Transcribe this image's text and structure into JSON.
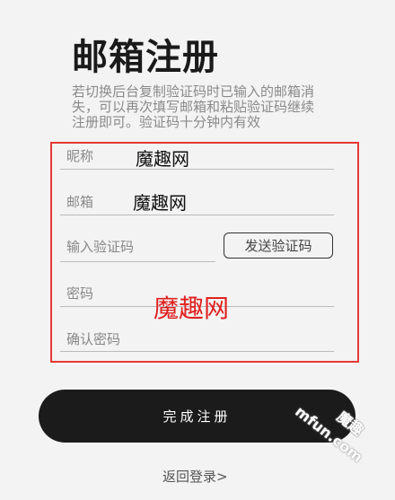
{
  "title": "邮箱注册",
  "description": "若切换后台复制验证码时已输入的邮箱消失，可以再次填写邮箱和粘贴验证码继续注册即可。验证码十分钟内有效",
  "form": {
    "nickname": {
      "label": "昵称",
      "value": "魔趣网"
    },
    "email": {
      "label": "邮箱",
      "value": "魔趣网"
    },
    "code": {
      "placeholder": "输入验证码",
      "send_label": "发送验证码"
    },
    "password": {
      "placeholder": "密码"
    },
    "confirm": {
      "placeholder": "确认密码"
    }
  },
  "annotation": {
    "text": "魔趣网",
    "color": "#e53935"
  },
  "submit_label": "完成注册",
  "back_label": "返回登录>",
  "corner_watermark": {
    "line1": "魔趣",
    "line2": "mfun.com"
  }
}
